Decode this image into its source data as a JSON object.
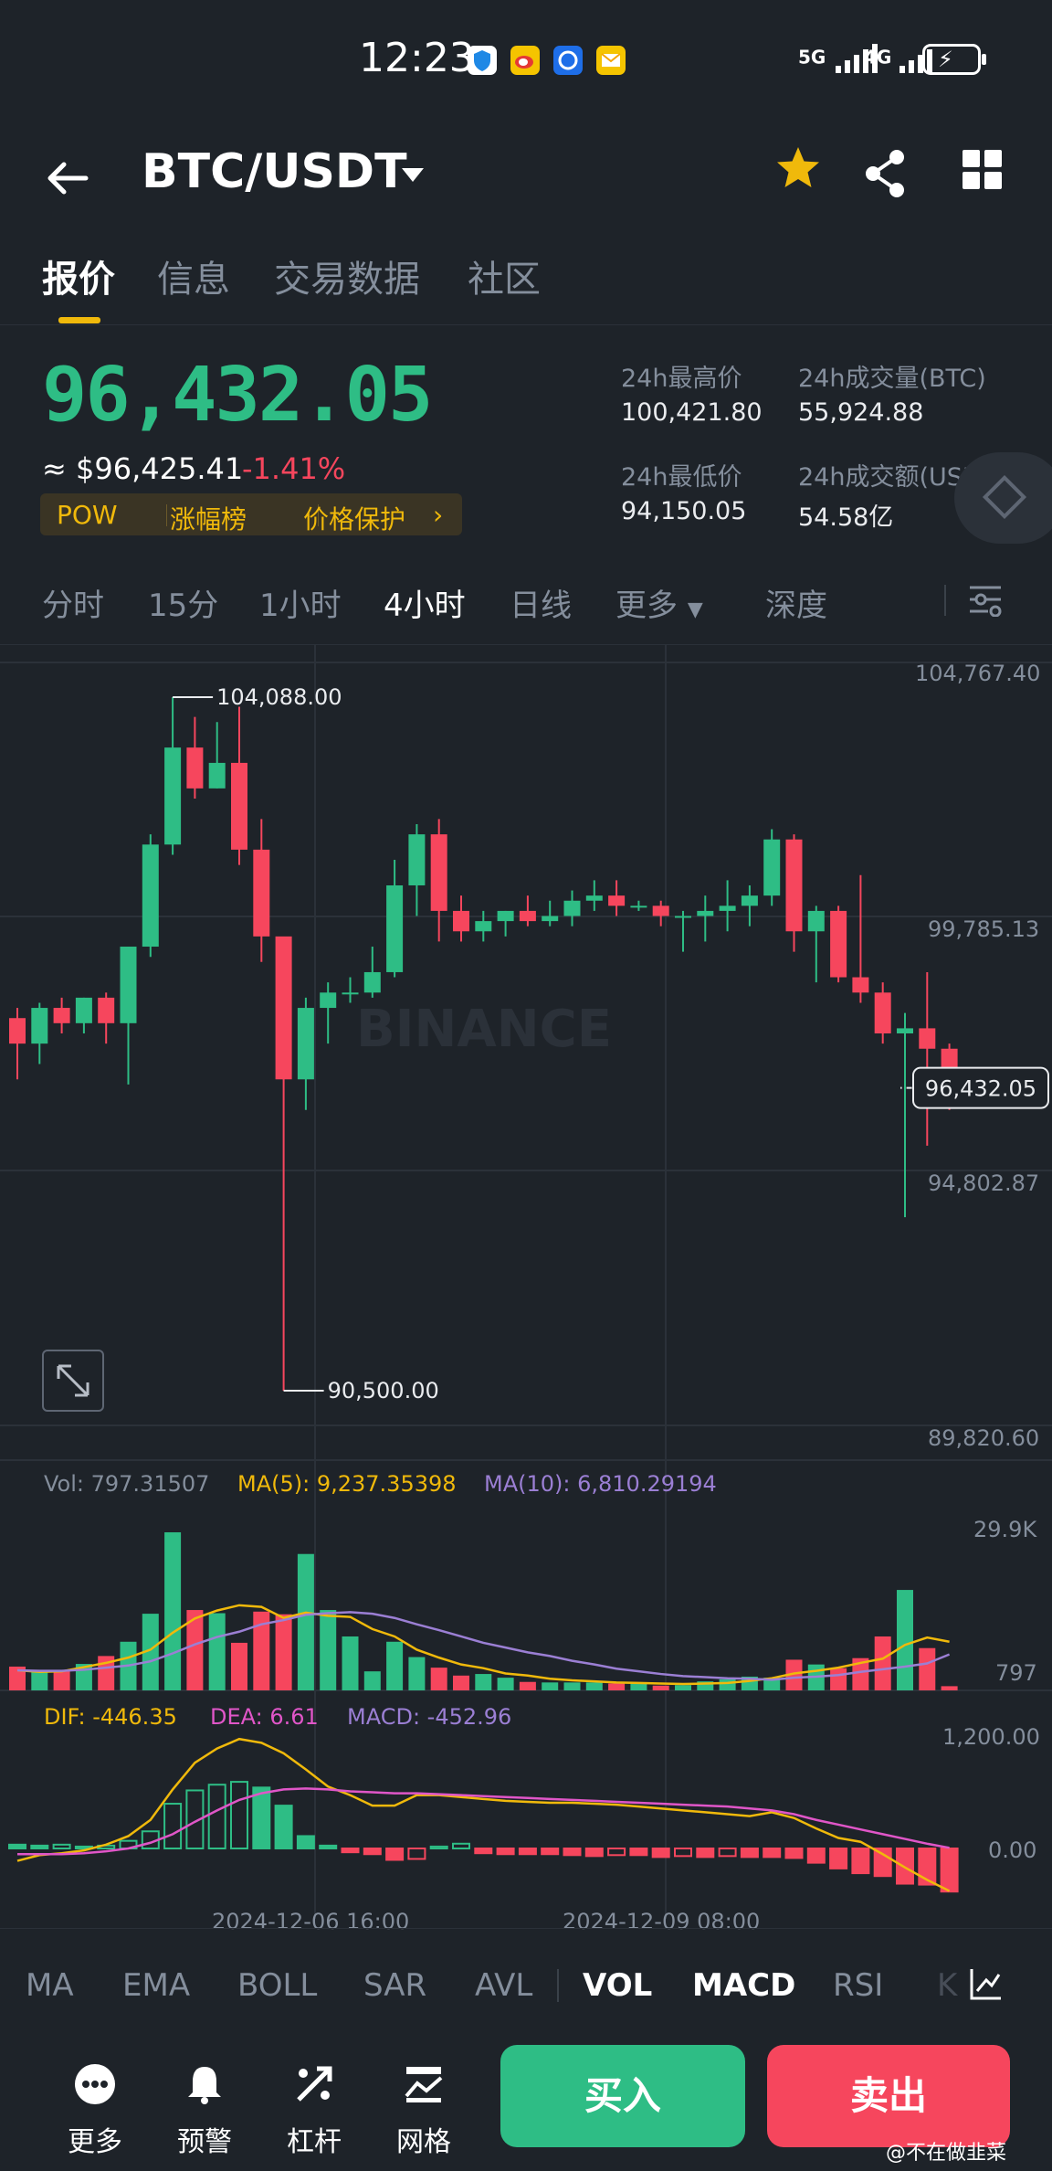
{
  "status_bar": {
    "time": "12:23",
    "sig1": "5G",
    "sig2": "4G"
  },
  "header": {
    "pair": "BTC/USDT"
  },
  "tabs": [
    "报价",
    "信息",
    "交易数据",
    "社区"
  ],
  "quote": {
    "price": "96,432.05",
    "approx": "≈ $96,425.41",
    "change": "-1.41%",
    "tags": [
      "POW",
      "涨幅榜",
      "价格保护"
    ],
    "stats": [
      {
        "label": "24h最高价",
        "value": "100,421.80"
      },
      {
        "label": "24h成交量(BTC)",
        "value": "55,924.88"
      },
      {
        "label": "24h最低价",
        "value": "94,150.05"
      },
      {
        "label": "24h成交额(USDT)",
        "value": "54.58亿"
      }
    ]
  },
  "intervals": [
    "分时",
    "15分",
    "1小时",
    "4小时",
    "日线",
    "更多",
    "深度"
  ],
  "chart_data": {
    "type": "candlestick",
    "price_axis_labels": [
      "104,767.40",
      "99,785.13",
      "94,802.87",
      "89,820.60"
    ],
    "ylim": [
      89820.6,
      104767.4
    ],
    "high_marker": "104,088.00",
    "low_marker": "90,500.00",
    "current_price_label": "96,432.05",
    "watermark": "BINANCE",
    "candles": [
      [
        97800,
        97300,
        98000,
        96600
      ],
      [
        97300,
        98000,
        98100,
        96900
      ],
      [
        98000,
        97700,
        98200,
        97500
      ],
      [
        97700,
        98200,
        98200,
        97500
      ],
      [
        98200,
        97700,
        98300,
        97300
      ],
      [
        97700,
        99200,
        99200,
        96500
      ],
      [
        99200,
        101200,
        101400,
        99000
      ],
      [
        101200,
        103100,
        104088,
        101000
      ],
      [
        103100,
        102300,
        103700,
        102100
      ],
      [
        102300,
        102800,
        103600,
        102300
      ],
      [
        102800,
        101100,
        103900,
        100800
      ],
      [
        101100,
        99400,
        101700,
        98900
      ],
      [
        99400,
        96600,
        99200,
        90500
      ],
      [
        96600,
        98000,
        98200,
        96000
      ],
      [
        98000,
        98300,
        98500,
        97300
      ],
      [
        98300,
        98300,
        98600,
        98100
      ],
      [
        98300,
        98700,
        99200,
        98200
      ],
      [
        98700,
        100400,
        100900,
        98600
      ],
      [
        100400,
        101400,
        101600,
        99800
      ],
      [
        101400,
        99900,
        101700,
        99300
      ],
      [
        99900,
        99500,
        100200,
        99300
      ],
      [
        99500,
        99700,
        99900,
        99300
      ],
      [
        99700,
        99900,
        99900,
        99400
      ],
      [
        99900,
        99700,
        100200,
        99600
      ],
      [
        99700,
        99800,
        100100,
        99600
      ],
      [
        99800,
        100100,
        100300,
        99600
      ],
      [
        100100,
        100200,
        100500,
        99900
      ],
      [
        100200,
        100000,
        100500,
        99800
      ],
      [
        100000,
        100000,
        100100,
        99900
      ],
      [
        100000,
        99800,
        100100,
        99600
      ],
      [
        99800,
        99800,
        99900,
        99100
      ],
      [
        99800,
        99900,
        100200,
        99300
      ],
      [
        99900,
        100000,
        100500,
        99500
      ],
      [
        100000,
        100200,
        100400,
        99600
      ],
      [
        100200,
        101300,
        101500,
        100000
      ],
      [
        101300,
        99500,
        101400,
        99100
      ],
      [
        99500,
        99900,
        100000,
        98500
      ],
      [
        99900,
        98600,
        100000,
        98500
      ],
      [
        98600,
        98300,
        100600,
        98100
      ],
      [
        98300,
        97500,
        98500,
        97300
      ],
      [
        97500,
        97600,
        97900,
        93900
      ],
      [
        97600,
        97200,
        98700,
        95300
      ],
      [
        97200,
        96432,
        97300,
        96000
      ]
    ],
    "time_labels": [
      "2024-12-06 16:00",
      "2024-12-09 08:00"
    ]
  },
  "volume": {
    "legend": {
      "vol": "Vol: 797.31507",
      "ma5": "MA(5): 9,237.35398",
      "ma10": "MA(10): 6,810.29194"
    },
    "axis": [
      "29.9K",
      "797"
    ],
    "bars": [
      4500,
      3800,
      3800,
      5000,
      6500,
      9200,
      14500,
      29900,
      15200,
      14600,
      9000,
      14900,
      14400,
      25800,
      15200,
      10200,
      3600,
      9200,
      6300,
      4300,
      2800,
      3100,
      2400,
      1600,
      1500,
      1500,
      1500,
      1300,
      1300,
      900,
      1000,
      1700,
      2100,
      2600,
      2400,
      5800,
      4900,
      4200,
      6100,
      10200,
      19000,
      8000,
      797
    ],
    "ma5": [
      3800,
      3500,
      3600,
      4400,
      5200,
      6200,
      7700,
      10900,
      13600,
      15100,
      16100,
      15800,
      13700,
      14700,
      14100,
      13900,
      11600,
      10200,
      7700,
      6200,
      4900,
      4200,
      3200,
      2800,
      2200,
      1900,
      1700,
      1500,
      1400,
      1300,
      1200,
      1300,
      1400,
      1800,
      2300,
      3200,
      3700,
      4300,
      5200,
      6000,
      8600,
      10000,
      9200
    ],
    "ma10": [
      3800,
      3700,
      3700,
      3900,
      4300,
      4700,
      5500,
      7000,
      8700,
      10100,
      11100,
      12500,
      13300,
      14300,
      14600,
      14800,
      14500,
      13700,
      12500,
      11400,
      10200,
      9000,
      8100,
      7200,
      6500,
      5600,
      4900,
      4100,
      3600,
      3100,
      2700,
      2500,
      2300,
      2200,
      2000,
      2400,
      2600,
      2900,
      3500,
      4000,
      4500,
      5100,
      6810
    ]
  },
  "macd": {
    "legend": {
      "dif": "DIF: -446.35",
      "dea": "DEA: 6.61",
      "macd": "MACD: -452.96"
    },
    "axis": [
      "1,200.00",
      "0.00"
    ],
    "hist": [
      40,
      30,
      40,
      20,
      30,
      80,
      180,
      470,
      610,
      670,
      700,
      640,
      450,
      130,
      30,
      -40,
      -60,
      -120,
      -110,
      20,
      50,
      -50,
      -60,
      -60,
      -60,
      -70,
      -80,
      -70,
      -70,
      -90,
      -80,
      -90,
      -80,
      -90,
      -90,
      -100,
      -150,
      -210,
      -260,
      -290,
      -370,
      -380,
      -453
    ],
    "dif": [
      -130,
      -70,
      -50,
      -20,
      40,
      130,
      300,
      620,
      900,
      1050,
      1150,
      1110,
      1000,
      830,
      650,
      560,
      450,
      450,
      560,
      560,
      540,
      520,
      500,
      490,
      480,
      480,
      470,
      460,
      440,
      420,
      400,
      380,
      360,
      340,
      380,
      320,
      210,
      110,
      70,
      -60,
      -200,
      -330,
      -446
    ],
    "dea": [
      -60,
      -60,
      -60,
      -50,
      -30,
      0,
      60,
      150,
      280,
      400,
      510,
      580,
      620,
      630,
      620,
      600,
      590,
      580,
      580,
      570,
      560,
      550,
      540,
      530,
      520,
      510,
      500,
      490,
      480,
      470,
      460,
      450,
      440,
      420,
      400,
      360,
      300,
      250,
      200,
      150,
      100,
      50,
      6.61
    ],
    "ylim": [
      -560,
      1560
    ]
  },
  "indicators": [
    "MA",
    "EMA",
    "BOLL",
    "SAR",
    "AVL",
    "VOL",
    "MACD",
    "RSI",
    "K"
  ],
  "bottom_bar": {
    "items": [
      {
        "icon": "more-icon",
        "label": "更多"
      },
      {
        "icon": "bell-icon",
        "label": "预警"
      },
      {
        "icon": "leverage-icon",
        "label": "杠杆"
      },
      {
        "icon": "grid-icon",
        "label": "网格"
      }
    ],
    "buy": "买入",
    "sell": "卖出"
  },
  "watermark": "@不在做韭菜",
  "colors": {
    "up": "#2ebd85",
    "down": "#f6465d",
    "accent": "#f0b90b",
    "bg": "#1e2329"
  }
}
